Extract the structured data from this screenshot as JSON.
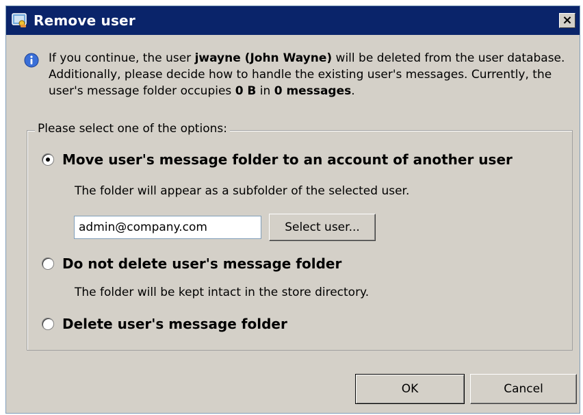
{
  "window": {
    "title": "Remove user",
    "close_glyph": "×",
    "icon": "app-user-icon"
  },
  "info": {
    "icon": "info-icon",
    "text_1": "If you continue, the user ",
    "user_bold": "jwayne (John Wayne)",
    "text_2": " will be deleted from the user database. Additionally, please decide how to handle the existing user's messages. Currently, the user's message folder occupies ",
    "size_bold": "0 B",
    "text_3": " in ",
    "count_bold": "0 messages",
    "text_4": "."
  },
  "options": {
    "group_label": "Please select one of the options:",
    "move": {
      "label": "Move user's message folder to an account of another user",
      "description": "The folder will appear as a subfolder of the selected user.",
      "input_value": "admin@company.com",
      "select_button": "Select user...",
      "checked": true
    },
    "keep": {
      "label": "Do not delete user's message folder",
      "description": "The folder will be kept intact in the store directory.",
      "checked": false
    },
    "delete": {
      "label": "Delete user's message folder",
      "checked": false
    }
  },
  "buttons": {
    "ok": "OK",
    "cancel": "Cancel"
  },
  "colors": {
    "titlebar": "#0a246a",
    "dialog_bg": "#d4d0c8",
    "info_icon": "#3a6fd8"
  }
}
